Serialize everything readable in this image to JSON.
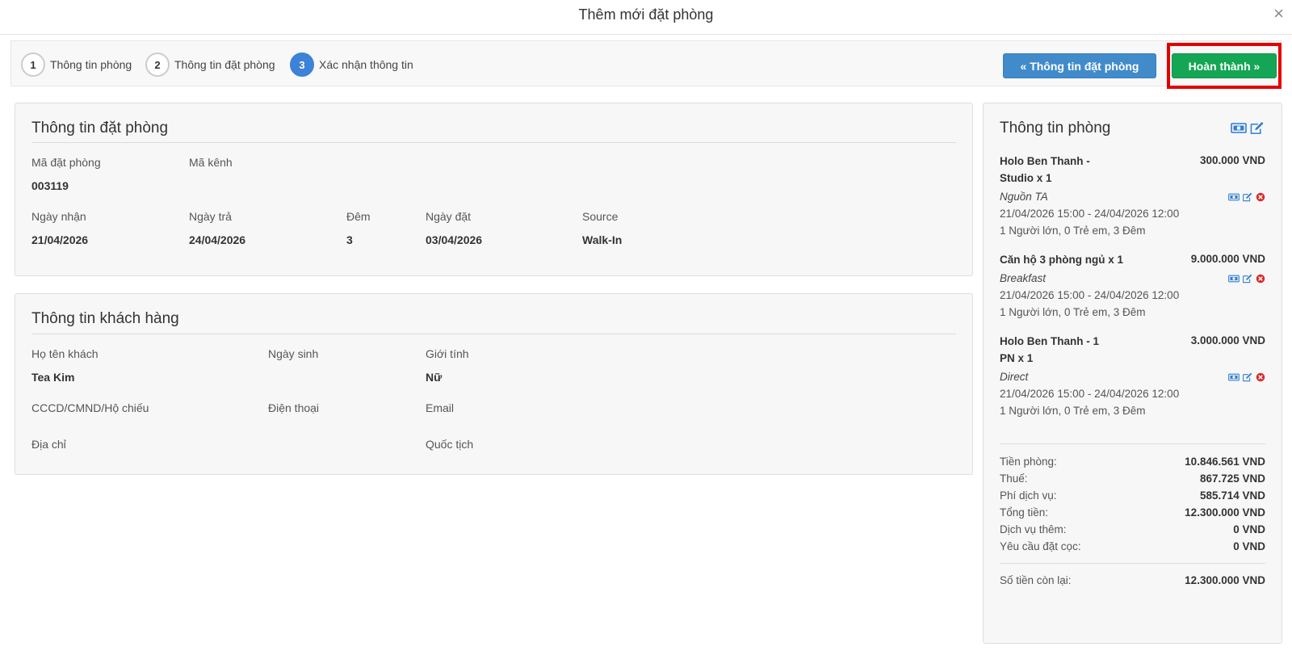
{
  "modal": {
    "title": "Thêm mới đặt phòng",
    "close": "×"
  },
  "steps": [
    {
      "num": "1",
      "label": "Thông tin phòng"
    },
    {
      "num": "2",
      "label": "Thông tin đặt phòng"
    },
    {
      "num": "3",
      "label": "Xác nhận thông tin"
    }
  ],
  "actions": {
    "back": "« Thông tin đặt phòng",
    "done": "Hoàn thành »"
  },
  "booking": {
    "title": "Thông tin đặt phòng",
    "code_label": "Mã đặt phòng",
    "code": "003119",
    "channel_code_label": "Mã kênh",
    "channel_code": "",
    "checkin_label": "Ngày nhận",
    "checkin": "21/04/2026",
    "checkout_label": "Ngày trả",
    "checkout": "24/04/2026",
    "nights_label": "Đêm",
    "nights": "3",
    "booked_label": "Ngày đặt",
    "booked": "03/04/2026",
    "source_label": "Source",
    "source": "Walk-In"
  },
  "guest": {
    "title": "Thông tin khách hàng",
    "name_label": "Họ tên khách",
    "name": "Tea Kim",
    "dob_label": "Ngày sinh",
    "dob": "",
    "gender_label": "Giới tính",
    "gender": "Nữ",
    "id_label": "CCCD/CMND/Hộ chiếu",
    "id": "",
    "phone_label": "Điện thoại",
    "phone": "",
    "email_label": "Email",
    "email": "",
    "address_label": "Địa chỉ",
    "address": "",
    "nationality_label": "Quốc tịch",
    "nationality": ""
  },
  "rooms": {
    "title": "Thông tin phòng",
    "items": [
      {
        "name": "Holo Ben Thanh - Studio x 1",
        "price": "300.000 VND",
        "source": "Nguồn TA",
        "dates": "21/04/2026 15:00 - 24/04/2026 12:00",
        "guests": "1 Người lớn, 0 Trẻ em, 3 Đêm"
      },
      {
        "name": "Căn hộ 3 phòng ngủ x 1",
        "price": "9.000.000 VND",
        "source": "Breakfast",
        "dates": "21/04/2026 15:00 - 24/04/2026 12:00",
        "guests": "1 Người lớn, 0 Trẻ em, 3 Đêm"
      },
      {
        "name": "Holo Ben Thanh - 1 PN x 1",
        "price": "3.000.000 VND",
        "source": "Direct",
        "dates": "21/04/2026 15:00 - 24/04/2026 12:00",
        "guests": "1 Người lớn, 0 Trẻ em, 3 Đêm"
      }
    ],
    "summary": [
      {
        "label": "Tiền phòng:",
        "value": "10.846.561 VND"
      },
      {
        "label": "Thuế:",
        "value": "867.725 VND"
      },
      {
        "label": "Phí dịch vụ:",
        "value": "585.714 VND"
      },
      {
        "label": "Tổng tiền:",
        "value": "12.300.000 VND"
      },
      {
        "label": "Dịch vụ thêm:",
        "value": "0 VND"
      },
      {
        "label": "Yêu cầu đặt cọc:",
        "value": "0 VND"
      }
    ],
    "remaining_label": "Số tiền còn lại:",
    "remaining": "12.300.000 VND"
  },
  "colors": {
    "primary": "#428bca",
    "success": "#14a655",
    "highlight": "#e40000",
    "step_active": "#3c82d6",
    "danger": "#d62c2c"
  },
  "icons": {
    "money": "money-icon",
    "edit": "edit-icon",
    "remove": "remove-icon"
  }
}
